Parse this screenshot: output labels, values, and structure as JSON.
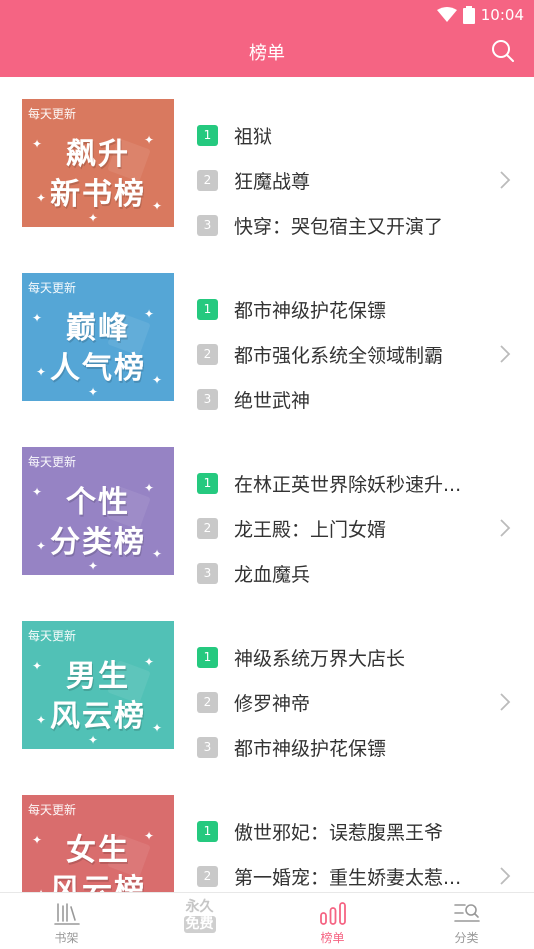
{
  "status": {
    "time": "10:04",
    "icons": [
      "wifi-icon",
      "battery-icon"
    ]
  },
  "header": {
    "title": "榜单",
    "search_icon": "search-icon",
    "color": "#f56483"
  },
  "ranks": [
    {
      "badge": "每天更新",
      "title_lines": [
        "飙升",
        "新书榜"
      ],
      "cover_color": "#d9795f",
      "items": [
        {
          "num": "1",
          "title": "祖狱"
        },
        {
          "num": "2",
          "title": "狂魔战尊"
        },
        {
          "num": "3",
          "title": "快穿：哭包宿主又开演了"
        }
      ]
    },
    {
      "badge": "每天更新",
      "title_lines": [
        "巅峰",
        "人气榜"
      ],
      "cover_color": "#55a6d6",
      "items": [
        {
          "num": "1",
          "title": "都市神级护花保镖"
        },
        {
          "num": "2",
          "title": "都市强化系统全领域制霸"
        },
        {
          "num": "3",
          "title": "绝世武神"
        }
      ]
    },
    {
      "badge": "每天更新",
      "title_lines": [
        "个性",
        "分类榜"
      ],
      "cover_color": "#9683c4",
      "items": [
        {
          "num": "1",
          "title": "在林正英世界除妖秒速升..."
        },
        {
          "num": "2",
          "title": "龙王殿：上门女婿"
        },
        {
          "num": "3",
          "title": "龙血魔兵"
        }
      ]
    },
    {
      "badge": "每天更新",
      "title_lines": [
        "男生",
        "风云榜"
      ],
      "cover_color": "#51c1b6",
      "items": [
        {
          "num": "1",
          "title": "神级系统万界大店长"
        },
        {
          "num": "2",
          "title": "修罗神帝"
        },
        {
          "num": "3",
          "title": "都市神级护花保镖"
        }
      ]
    },
    {
      "badge": "每天更新",
      "title_lines": [
        "女生",
        "风云榜"
      ],
      "cover_color": "#d96d6d",
      "items": [
        {
          "num": "1",
          "title": "傲世邪妃：误惹腹黑王爷"
        },
        {
          "num": "2",
          "title": "第一婚宠：重生娇妻太惹..."
        }
      ]
    }
  ],
  "tabbar": {
    "tabs": [
      {
        "label": "书架",
        "icon": "bookshelf-icon",
        "active": false
      },
      {
        "label": "",
        "icon": "free-logo-icon",
        "logo_text": [
          "永久",
          "免费"
        ],
        "active": false
      },
      {
        "label": "榜单",
        "icon": "chart-bars-icon",
        "active": true
      },
      {
        "label": "分类",
        "icon": "category-search-icon",
        "active": false
      }
    ]
  },
  "colors": {
    "accent": "#f56483",
    "rank_top": "#25c97f",
    "rank_rest": "#c9c9c9"
  }
}
